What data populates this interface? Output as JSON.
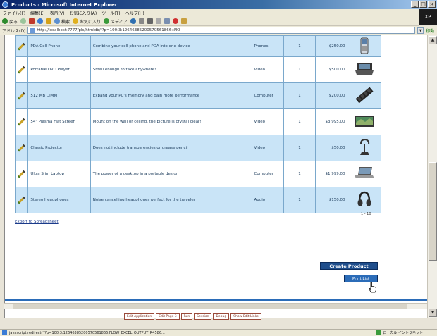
{
  "window": {
    "title": "Products - Microsoft Internet Explorer",
    "controls": [
      "_",
      "□",
      "×"
    ],
    "throbber": "XP"
  },
  "menubar": [
    "ファイル(F)",
    "編集(E)",
    "表示(V)",
    "お気に入り(A)",
    "ツール(T)",
    "ヘルプ(H)"
  ],
  "toolbar": {
    "back": "戻る",
    "search": "検索",
    "favorites": "お気に入り",
    "media": "メディア"
  },
  "address": {
    "label": "アドレス(D)",
    "value": "http://localhost:7777/pls/htmldb/f?p=100:3:12646385200570561866::NO",
    "go": "移動"
  },
  "products": [
    {
      "name": "PDA Cell Phone",
      "description": "Combine your cell phone and PDA into one device",
      "category": "Phones",
      "qty": "1",
      "price": "$250.00",
      "image": "phone-icon"
    },
    {
      "name": "Portable DVD Player",
      "description": "Small enough to take anywhere!",
      "category": "Video",
      "qty": "1",
      "price": "$500.00",
      "image": "dvd-player-icon"
    },
    {
      "name": "512 MB DIMM",
      "description": "Expand your PC's memory and gain more performance",
      "category": "Computer",
      "qty": "1",
      "price": "$200.00",
      "image": "memory-icon"
    },
    {
      "name": "54\" Plasma Flat Screen",
      "description": "Mount on the wall or ceiling, the picture is crystal clear!",
      "category": "Video",
      "qty": "1",
      "price": "$3,995.00",
      "image": "tv-icon"
    },
    {
      "name": "Classic Projector",
      "description": "Does not include transparencies or grease pencil",
      "category": "Video",
      "qty": "1",
      "price": "$50.00",
      "image": "projector-icon"
    },
    {
      "name": "Ultra Slim Laptop",
      "description": "The power of a desktop in a portable design",
      "category": "Computer",
      "qty": "1",
      "price": "$1,999.00",
      "image": "laptop-icon"
    },
    {
      "name": "Stereo Headphones",
      "description": "Noise cancelling headphones perfect for the traveler",
      "category": "Audio",
      "qty": "1",
      "price": "$150.00",
      "image": "headphones-icon"
    }
  ],
  "pager": "1 - 10",
  "export_link": "Export to Spreadsheet",
  "buttons": {
    "create": "Create Product",
    "print": "Print List"
  },
  "navlinks": [
    "Edit Application",
    "Edit Page 3",
    "Run",
    "Session",
    "Debug",
    "Show Edit Links"
  ],
  "status": {
    "text": "javascript:redirect('f?p=100:3:12646385200570561866:FLOW_EXCEL_OUTPUT_R4586...",
    "zone": "ローカル イントラネット"
  },
  "colors": {
    "row_alt": "#c9e4f7",
    "button_primary": "#1f4e8c",
    "accent_rule": "#2b6cb8"
  }
}
